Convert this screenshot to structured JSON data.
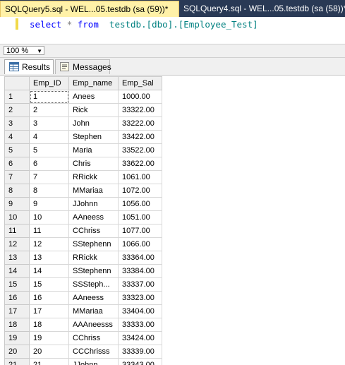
{
  "tabs": {
    "active": "SQLQuery5.sql - WEL...05.testdb (sa (59))*",
    "inactive": "SQLQuery4.sql - WEL...05.testdb (sa (58))*"
  },
  "editor": {
    "kw_select": "select",
    "star": "*",
    "kw_from": "from",
    "table": "testdb.[dbo].[Employee_Test]"
  },
  "zoom": "100 %",
  "result_tabs": {
    "results": "Results",
    "messages": "Messages"
  },
  "grid": {
    "columns": [
      "Emp_ID",
      "Emp_name",
      "Emp_Sal"
    ],
    "rows": [
      [
        "1",
        "1",
        "Anees",
        "1000.00"
      ],
      [
        "2",
        "2",
        "Rick",
        "33322.00"
      ],
      [
        "3",
        "3",
        "John",
        "33222.00"
      ],
      [
        "4",
        "4",
        "Stephen",
        "33422.00"
      ],
      [
        "5",
        "5",
        "Maria",
        "33522.00"
      ],
      [
        "6",
        "6",
        "Chris",
        "33622.00"
      ],
      [
        "7",
        "7",
        "RRickk",
        "1061.00"
      ],
      [
        "8",
        "8",
        "MMariaa",
        "1072.00"
      ],
      [
        "9",
        "9",
        "JJohnn",
        "1056.00"
      ],
      [
        "10",
        "10",
        "AAneess",
        "1051.00"
      ],
      [
        "11",
        "11",
        "CChriss",
        "1077.00"
      ],
      [
        "12",
        "12",
        "SStephenn",
        "1066.00"
      ],
      [
        "13",
        "13",
        "RRickk",
        "33364.00"
      ],
      [
        "14",
        "14",
        "SStephenn",
        "33384.00"
      ],
      [
        "15",
        "15",
        "SSSteph...",
        "33337.00"
      ],
      [
        "16",
        "16",
        "AAneess",
        "33323.00"
      ],
      [
        "17",
        "17",
        "MMariaa",
        "33404.00"
      ],
      [
        "18",
        "18",
        "AAAneesss",
        "33333.00"
      ],
      [
        "19",
        "19",
        "CChriss",
        "33424.00"
      ],
      [
        "20",
        "20",
        "CCChrisss",
        "33339.00"
      ],
      [
        "21",
        "21",
        "JJohnn",
        "33343.00"
      ]
    ]
  }
}
